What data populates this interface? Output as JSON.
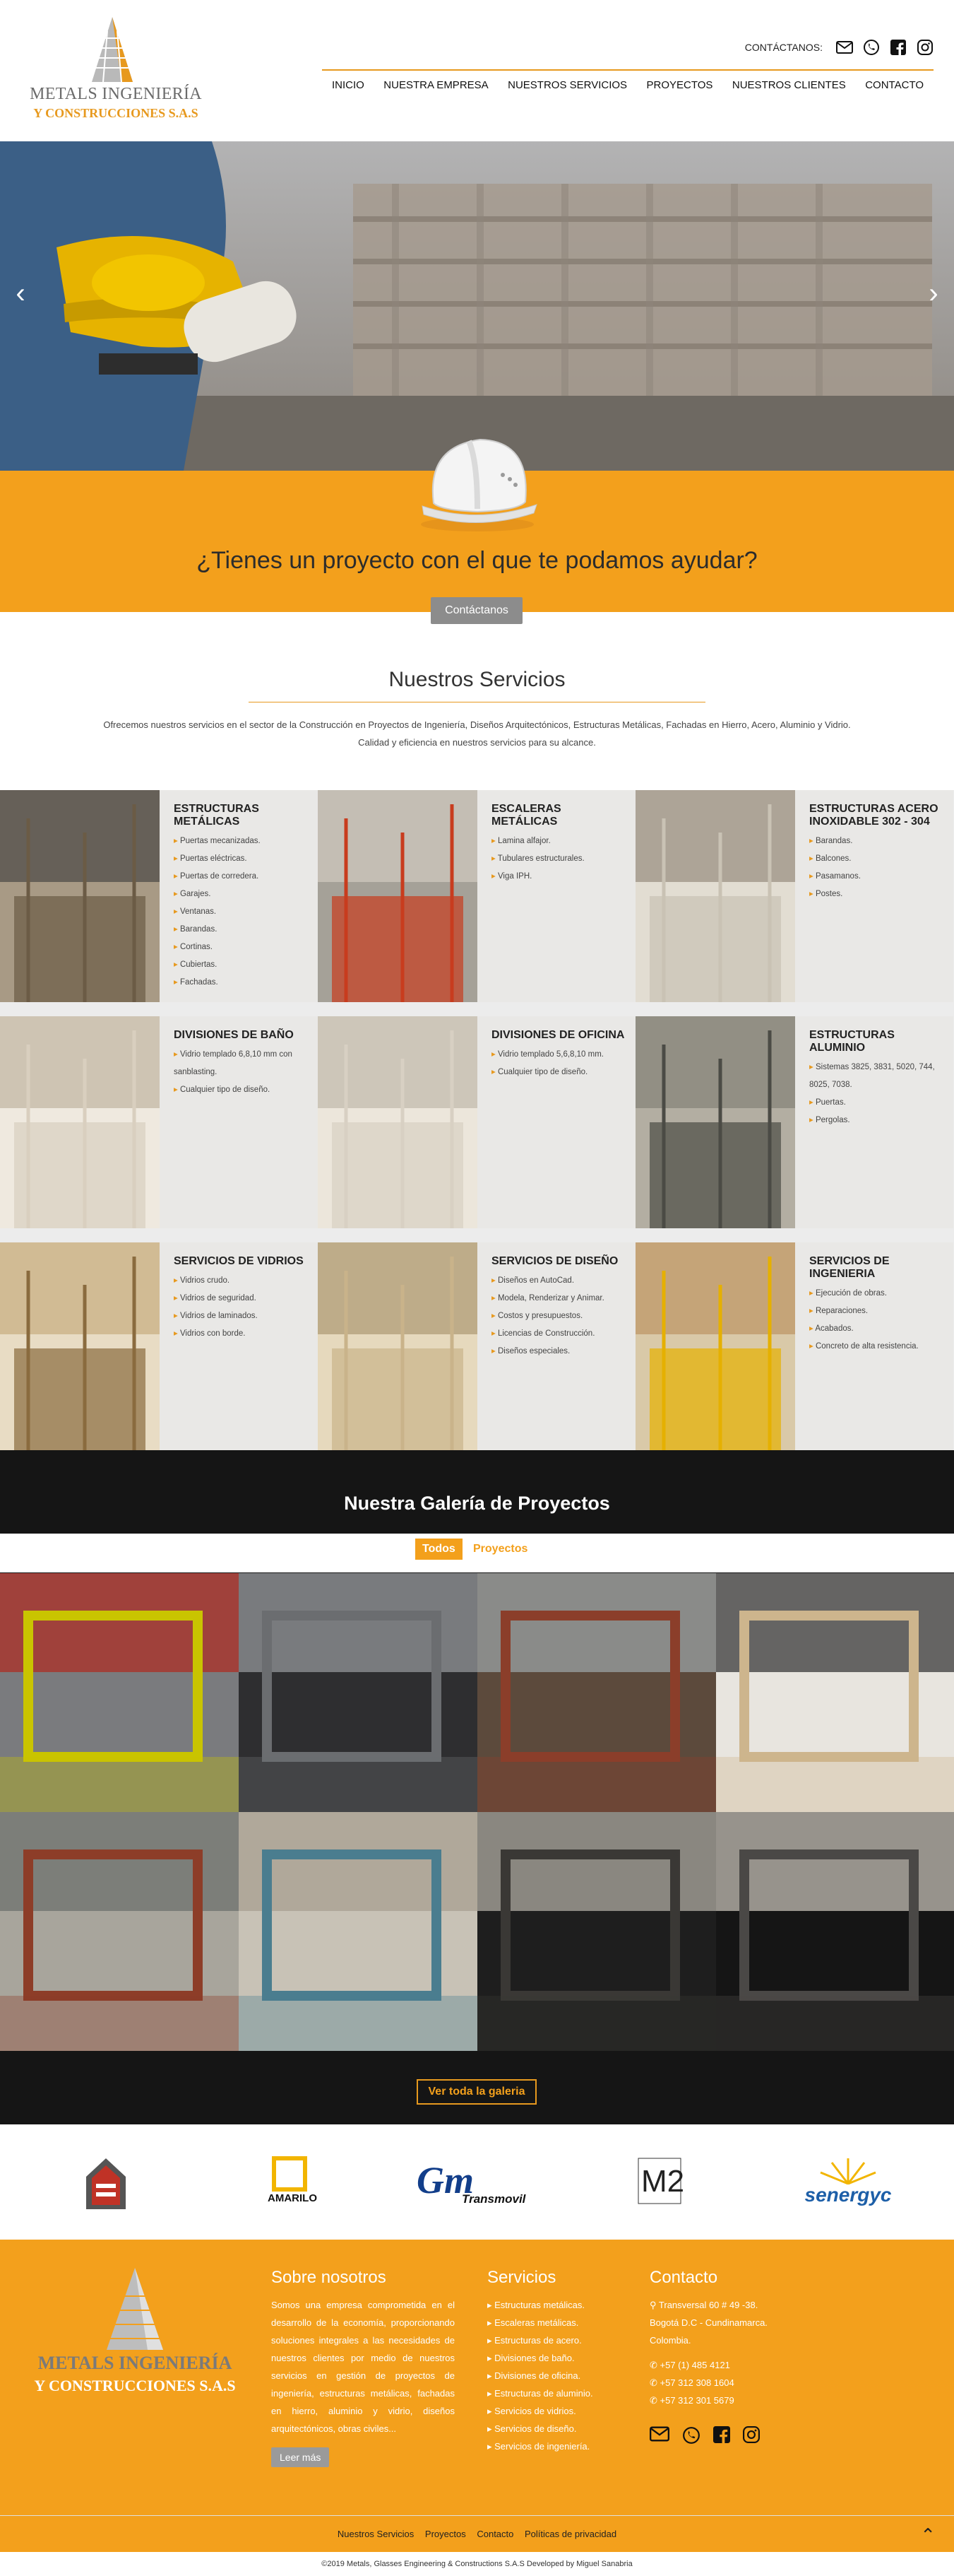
{
  "header": {
    "logo_line1": "METALS INGENIERÍA",
    "logo_line2": "Y CONSTRUCCIONES S.A.S",
    "contact_label": "CONTÁCTANOS:",
    "nav": [
      "INICIO",
      "NUESTRA EMPRESA",
      "NUESTROS SERVICIOS",
      "PROYECTOS",
      "NUESTROS CLIENTES",
      "CONTACTO"
    ],
    "icons": [
      "envelope-icon",
      "whatsapp-icon",
      "facebook-icon",
      "instagram-icon"
    ]
  },
  "hero": {
    "prev": "‹",
    "next": "›"
  },
  "cta": {
    "question": "¿Tienes un proyecto con el que te podamos ayudar?",
    "button": "Contáctanos"
  },
  "services": {
    "title": "Nuestros Servicios",
    "desc": "Ofrecemos nuestros servicios en el sector de la Construcción en Proyectos de Ingeniería, Diseños Arquitectónicos, Estructuras Metálicas, Fachadas en Hierro, Acero, Aluminio y Vidrio.",
    "desc2": "Calidad y eficiencia en nuestros servicios para su alcance.",
    "items": [
      {
        "title": "ESTRUCTURAS METÁLICAS",
        "list": [
          "Puertas mecanizadas.",
          "Puertas eléctricas.",
          "Puertas de corredera.",
          "Garajes.",
          "Ventanas.",
          "Barandas.",
          "Cortinas.",
          "Cubiertas.",
          "Fachadas."
        ]
      },
      {
        "title": "ESCALERAS METÁLICAS",
        "list": [
          "Lamina alfajor.",
          "Tubulares estructurales.",
          "Viga IPH."
        ]
      },
      {
        "title": "ESTRUCTURAS ACERO INOXIDABLE 302 - 304",
        "list": [
          "Barandas.",
          "Balcones.",
          "Pasamanos.",
          "Postes."
        ]
      },
      {
        "title": "DIVISIONES DE BAÑO",
        "list": [
          "Vidrio templado 6,8,10 mm con sanblasting.",
          "Cualquier tipo de diseño."
        ]
      },
      {
        "title": "DIVISIONES DE OFICINA",
        "list": [
          "Vidrio templado 5,6,8,10 mm.",
          "Cualquier tipo de diseño."
        ]
      },
      {
        "title": "ESTRUCTURAS ALUMINIO",
        "list": [
          "Sistemas 3825, 3831, 5020, 744, 8025, 7038.",
          "Puertas.",
          "Pergolas."
        ]
      },
      {
        "title": "SERVICIOS DE VIDRIOS",
        "list": [
          "Vidrios crudo.",
          "Vidrios de seguridad.",
          "Vidrios de laminados.",
          "Vidrios con borde."
        ]
      },
      {
        "title": "SERVICIOS DE DISEÑO",
        "list": [
          "Diseños en AutoCad.",
          "Modela, Renderizar y Animar.",
          "Costos y presupuestos.",
          "Licencias de Construcción.",
          "Diseños especiales."
        ]
      },
      {
        "title": "SERVICIOS DE INGENIERIA",
        "list": [
          "Ejecución de obras.",
          "Reparaciones.",
          "Acabados.",
          "Concreto de alta resistencia."
        ]
      }
    ]
  },
  "gallery": {
    "title": "Nuestra Galería de Proyectos",
    "tab_all": "Todos",
    "tab_projects": "Proyectos",
    "see_all": "Ver toda la galeria"
  },
  "clients": {
    "amarilo": "AMARILO",
    "gm": "Gm",
    "transmovil": "Transmovil",
    "m2": "M2",
    "senergyc": "senergyc"
  },
  "footer": {
    "logo_line1": "METALS INGENIERÍA",
    "logo_line2": "Y CONSTRUCCIONES S.A.S",
    "about_title": "Sobre nosotros",
    "about_text": "Somos una empresa comprometida en el desarrollo de la economía, proporcionando soluciones integrales a las necesidades de nuestros clientes por medio de nuestros servicios en gestión de proyectos de ingeniería, estructuras metálicas, fachadas en hierro, aluminio y vidrio, diseños arquitectónicos, obras civiles...",
    "read_more": "Leer más",
    "services_title": "Servicios",
    "services": [
      "Estructuras metálicas.",
      "Escaleras metálicas.",
      "Estructuras de acero.",
      "Divisiones de baño.",
      "Divisiones de oficina.",
      "Estructuras de aluminio.",
      "Servicios de vidrios.",
      "Servicios de diseño.",
      "Servicios de ingeniería."
    ],
    "contact_title": "Contacto",
    "address1": "Transversal 60 # 49 -38.",
    "address2": "Bogotá D.C - Cundinamarca.",
    "address3": "Colombia.",
    "phone1": "+57 (1) 485 4121",
    "phone2": "+57 312 308 1604",
    "phone3": "+57 312 301 5679"
  },
  "bottom": {
    "links": [
      "Nuestros Servicios",
      "Proyectos",
      "Contacto",
      "Políticas de privacidad"
    ],
    "copyright": "©2019 Metals, Glasses Engineering & Constructions S.A.S Developed by Miguel Sanabria"
  }
}
